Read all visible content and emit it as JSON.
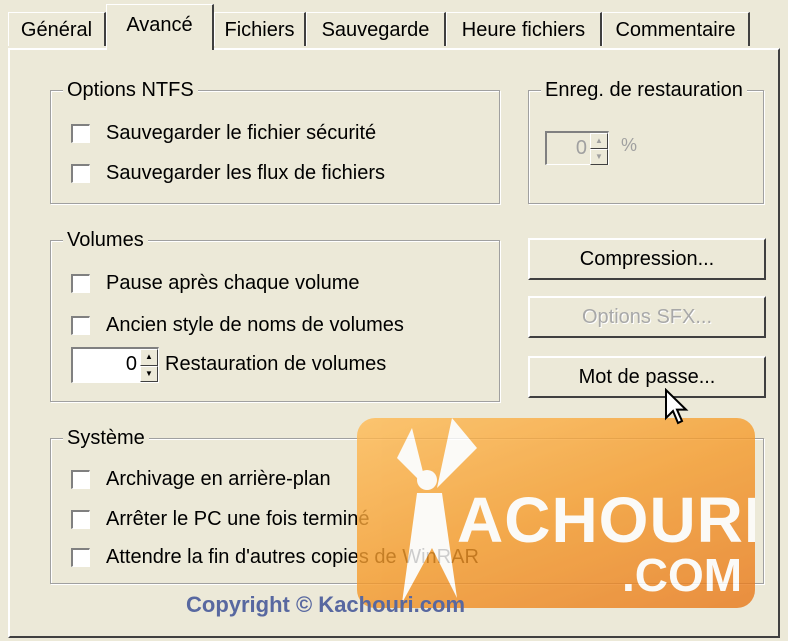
{
  "tabs": [
    {
      "label": "Général"
    },
    {
      "label": "Avancé"
    },
    {
      "label": "Fichiers"
    },
    {
      "label": "Sauvegarde"
    },
    {
      "label": "Heure fichiers"
    },
    {
      "label": "Commentaire"
    }
  ],
  "ntfs": {
    "title": "Options NTFS",
    "save_security": "Sauvegarder le fichier sécurité",
    "save_streams": "Sauvegarder les flux de fichiers"
  },
  "recovery": {
    "title": "Enreg. de restauration",
    "value": "0",
    "unit": "%"
  },
  "volumes": {
    "title": "Volumes",
    "pause": "Pause après chaque volume",
    "old_style": "Ancien style de noms de volumes",
    "recovery_value": "0",
    "recovery_label": "Restauration de volumes"
  },
  "buttons": {
    "compression": "Compression...",
    "sfx": "Options SFX...",
    "password": "Mot de passe..."
  },
  "system": {
    "title": "Système",
    "background": "Archivage en arrière-plan",
    "shutdown": "Arrêter le PC une fois terminé",
    "wait": "Attendre la fin d'autres copies de WinRAR"
  },
  "watermark": {
    "brand": "ACHOURI",
    "tld": ".COM",
    "copyright": "Copyright © Kachouri.com"
  }
}
